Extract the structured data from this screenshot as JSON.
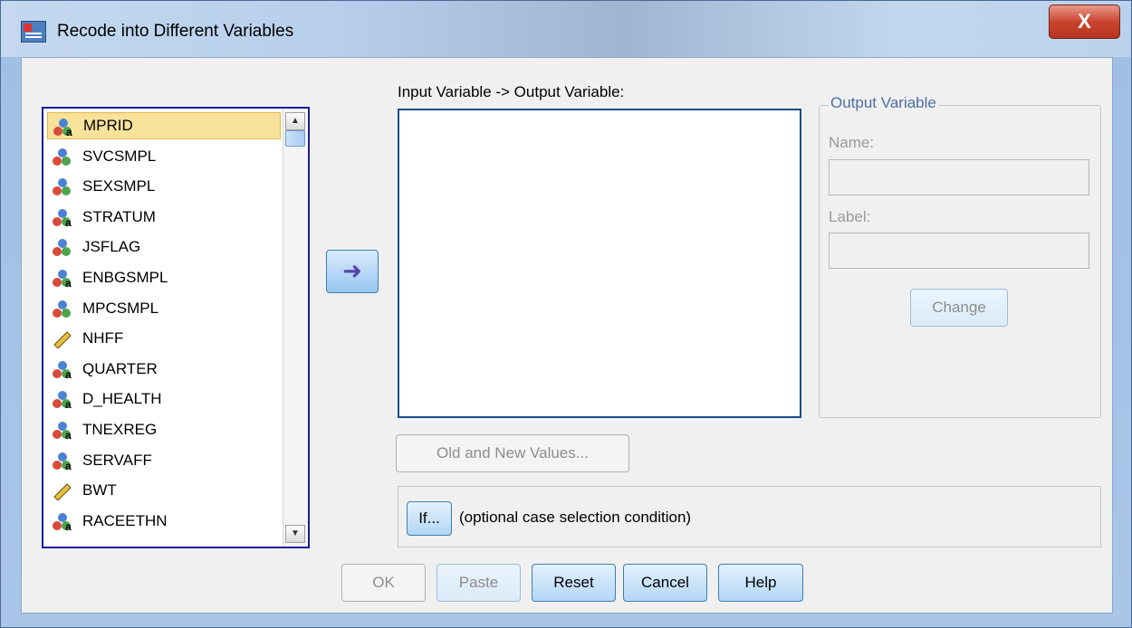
{
  "window": {
    "title": "Recode into Different Variables",
    "close_glyph": "X"
  },
  "variables": [
    {
      "name": "MPRID",
      "type": "nominal-string",
      "selected": true
    },
    {
      "name": "SVCSMPL",
      "type": "nominal"
    },
    {
      "name": "SEXSMPL",
      "type": "nominal"
    },
    {
      "name": "STRATUM",
      "type": "nominal-string"
    },
    {
      "name": "JSFLAG",
      "type": "nominal"
    },
    {
      "name": "ENBGSMPL",
      "type": "nominal-string"
    },
    {
      "name": "MPCSMPL",
      "type": "nominal"
    },
    {
      "name": "NHFF",
      "type": "scale"
    },
    {
      "name": "QUARTER",
      "type": "nominal-string"
    },
    {
      "name": "D_HEALTH",
      "type": "nominal-string"
    },
    {
      "name": "TNEXREG",
      "type": "nominal-string"
    },
    {
      "name": "SERVAFF",
      "type": "nominal-string"
    },
    {
      "name": "BWT",
      "type": "scale"
    },
    {
      "name": "RACEETHN",
      "type": "nominal-string"
    }
  ],
  "move_button": {
    "icon": "arrow-right-icon",
    "glyph": "➜"
  },
  "mapping": {
    "label": "Input Variable -> Output Variable:"
  },
  "output": {
    "group_title": "Output Variable",
    "name_label": "Name:",
    "label_label": "Label:",
    "change_button": "Change"
  },
  "old_new_button": "Old and New Values...",
  "if_button": "If...",
  "if_text": "(optional case selection condition)",
  "footer": {
    "ok": "OK",
    "paste": "Paste",
    "reset": "Reset",
    "cancel": "Cancel",
    "help": "Help"
  },
  "colors": {
    "accent": "#1a1a9c",
    "selected_row": "#f8e29a",
    "close": "#c9452f"
  }
}
